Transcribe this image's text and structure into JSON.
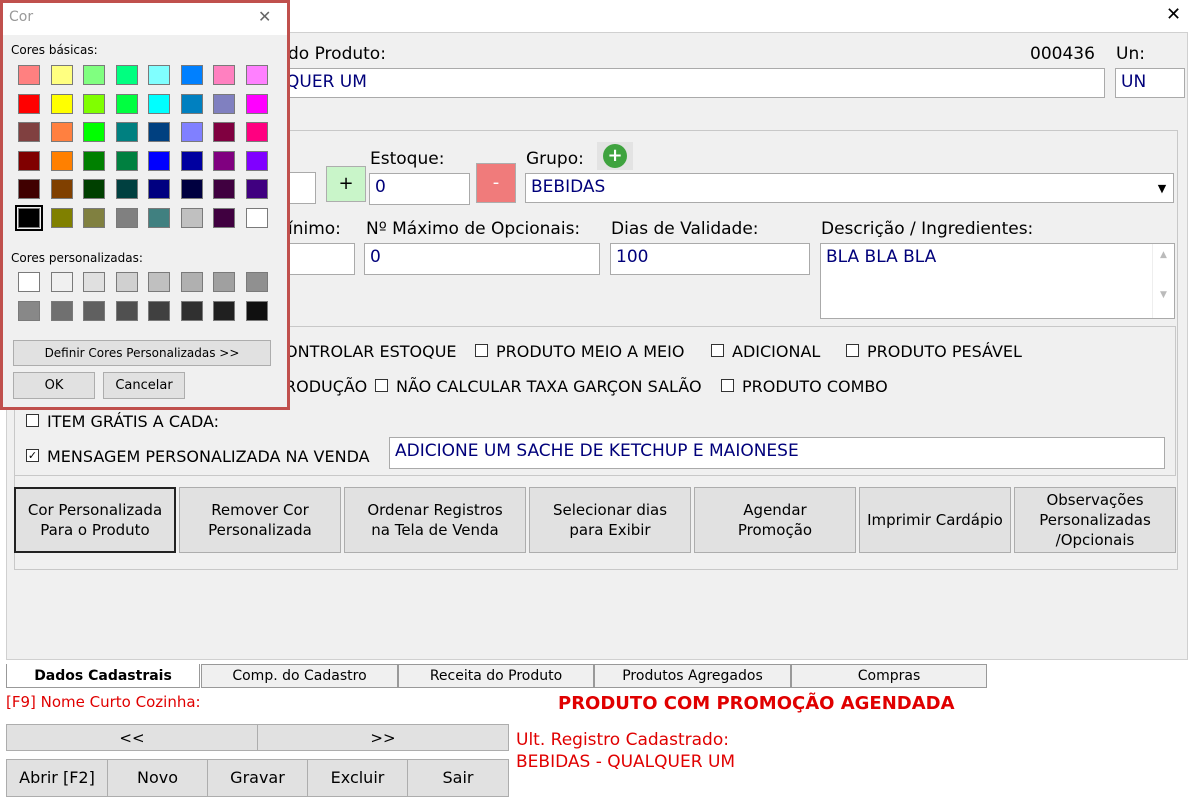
{
  "main": {
    "product_label": "do Produto:",
    "code": "000436",
    "unit_label": "Un:",
    "product_name": "QUER UM",
    "unit_value": "UN",
    "plus_label": "+",
    "minus_label": "-",
    "stock_label": "Estoque:",
    "stock_value": "0",
    "group_label": "Grupo:",
    "group_value": "BEBIDAS",
    "min_label": "ínimo:",
    "max_optional_label": "Nº Máximo de Opcionais:",
    "max_optional_value": "0",
    "validity_label": "Dias de Validade:",
    "validity_value": "100",
    "description_label": "Descrição / Ingredientes:",
    "description_value": "BLA BLA BLA",
    "checkboxes_row1": [
      {
        "label": "ONTROLAR ESTOQUE",
        "checked": false,
        "partial": true
      },
      {
        "label": "PRODUTO MEIO A MEIO",
        "checked": false
      },
      {
        "label": "ADICIONAL",
        "checked": false
      },
      {
        "label": "PRODUTO PESÁVEL",
        "checked": false
      }
    ],
    "checkboxes_row2": [
      {
        "label": "RODUÇÃO",
        "checked": false,
        "partial": true
      },
      {
        "label": "NÃO CALCULAR TAXA GARÇON SALÃO",
        "checked": false
      },
      {
        "label": "PRODUTO COMBO",
        "checked": false
      }
    ],
    "free_item_label": "ITEM GRÁTIS A CADA:",
    "message_label": "MENSAGEM PERSONALIZADA NA VENDA",
    "message_checked": "✓",
    "message_value": "ADICIONE UM SACHE DE KETCHUP E MAIONESE",
    "action_buttons": [
      "Cor Personalizada\nPara o Produto",
      "Remover Cor\nPersonalizada",
      "Ordenar Registros\nna Tela de Venda",
      "Selecionar dias\npara  Exibir",
      "Agendar\nPromoção",
      "Imprimir Cardápio",
      "Observações\nPersonalizadas\n/Opcionais"
    ],
    "tabs": [
      "Dados Cadastrais",
      "Comp. do Cadastro",
      "Receita do Produto",
      "Produtos Agregados",
      "Compras"
    ],
    "f9_label": "[F9] Nome Curto Cozinha:",
    "promo_notice": "PRODUTO COM PROMOÇÃO AGENDADA",
    "nav_prev": "<<",
    "nav_next": ">>",
    "last_record_label": "Ult. Registro Cadastrado:",
    "last_record_value": "BEBIDAS - QUALQUER UM",
    "bottom_buttons": [
      "Abrir [F2]",
      "Novo",
      "Gravar",
      "Excluir",
      "Sair"
    ],
    "close_glyph": "✕",
    "scroll_up": "▲",
    "scroll_down": "▼",
    "combo_arrow": "▼"
  },
  "color_dialog": {
    "title": "Cor",
    "close_glyph": "✕",
    "basic_label": "Cores básicas:",
    "custom_label": "Cores personalizadas:",
    "define_button": "Definir Cores Personalizadas >>",
    "ok_button": "OK",
    "cancel_button": "Cancelar",
    "basic_colors": [
      [
        "#ff8080",
        "#ffff80",
        "#80ff80",
        "#00ff80",
        "#80ffff",
        "#0080ff",
        "#ff80c0",
        "#ff80ff"
      ],
      [
        "#ff0000",
        "#ffff00",
        "#80ff00",
        "#00ff40",
        "#00ffff",
        "#0080c0",
        "#8080c0",
        "#ff00ff"
      ],
      [
        "#804040",
        "#ff8040",
        "#00ff00",
        "#008080",
        "#004080",
        "#8080ff",
        "#800040",
        "#ff0080"
      ],
      [
        "#800000",
        "#ff8000",
        "#008000",
        "#008040",
        "#0000ff",
        "#0000a0",
        "#800080",
        "#8000ff"
      ],
      [
        "#400000",
        "#804000",
        "#004000",
        "#004040",
        "#000080",
        "#000040",
        "#400040",
        "#400080"
      ],
      [
        "#000000",
        "#808000",
        "#808040",
        "#808080",
        "#408080",
        "#c0c0c0",
        "#400040",
        "#ffffff"
      ]
    ],
    "custom_colors": [
      [
        "#ffffff",
        "#f0f0f0",
        "#e0e0e0",
        "#d0d0d0",
        "#c0c0c0",
        "#b0b0b0",
        "#a0a0a0",
        "#909090"
      ],
      [
        "#888888",
        "#707070",
        "#606060",
        "#505050",
        "#404040",
        "#303030",
        "#202020",
        "#101010"
      ]
    ],
    "accent_border": "#c0504d"
  }
}
